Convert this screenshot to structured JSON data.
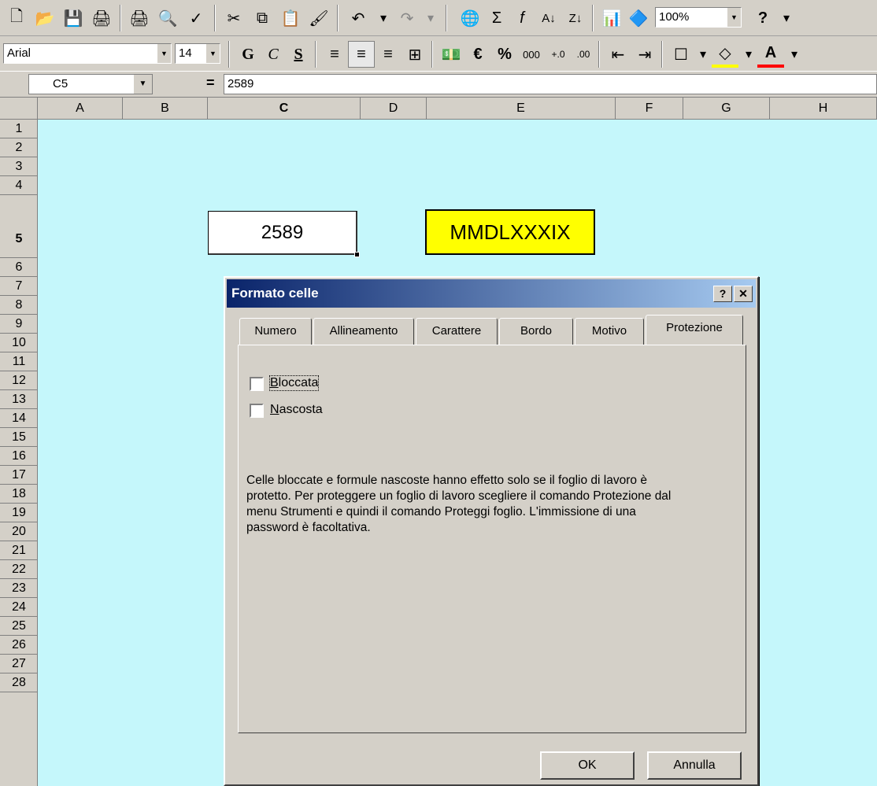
{
  "toolbar1": {
    "icons": [
      "new-icon",
      "open-icon",
      "save-icon",
      "permission-icon",
      "print-icon",
      "print-preview-icon",
      "spelling-icon",
      "cut-icon",
      "copy-icon",
      "paste-icon",
      "format-painter-icon",
      "undo-icon",
      "redo-icon",
      "hyperlink-icon",
      "autosum-icon",
      "function-icon",
      "sort-ascending-icon",
      "sort-descending-icon",
      "chart-wizard-icon",
      "drawing-icon"
    ],
    "zoom": "100%",
    "help_glyph": "?"
  },
  "toolbar2": {
    "font": "Arial",
    "size": "14",
    "bold": "G",
    "italic": "C",
    "underline": "S",
    "percent": "%",
    "euro": "€",
    "thousands": "000"
  },
  "formula_bar": {
    "name_box": "C5",
    "equals": "=",
    "value": "2589"
  },
  "columns": [
    "A",
    "B",
    "C",
    "D",
    "E",
    "F",
    "G",
    "H"
  ],
  "rows": [
    "1",
    "2",
    "3",
    "4",
    "5",
    "6",
    "7",
    "8",
    "9",
    "10",
    "11",
    "12",
    "13",
    "14",
    "15",
    "16",
    "17",
    "18",
    "19",
    "20",
    "21",
    "22",
    "23",
    "24",
    "25",
    "26",
    "27",
    "28"
  ],
  "cells": {
    "C5": "2589",
    "E5": "MMDLXXXIX"
  },
  "colors": {
    "sheet_bg": "#c5f7fb",
    "roman_cell_bg": "#ffff00",
    "title_bar_start": "#0a246a"
  },
  "dialog": {
    "title": "Formato celle",
    "help_button": "?",
    "close_button": "✕",
    "tabs": [
      "Numero",
      "Allineamento",
      "Carattere",
      "Bordo",
      "Motivo",
      "Protezione"
    ],
    "active_tab": "Protezione",
    "checkbox_locked": {
      "label": "Bloccata",
      "checked": false
    },
    "checkbox_hidden": {
      "label": "Nascosta",
      "checked": false
    },
    "info_text": "Celle bloccate e formule nascoste hanno effetto solo se il foglio di lavoro è protetto. Per proteggere un foglio di lavoro scegliere il comando Protezione dal menu Strumenti e quindi il comando Proteggi foglio. L'immissione di una password è facoltativa.",
    "ok_label": "OK",
    "cancel_label": "Annulla"
  }
}
